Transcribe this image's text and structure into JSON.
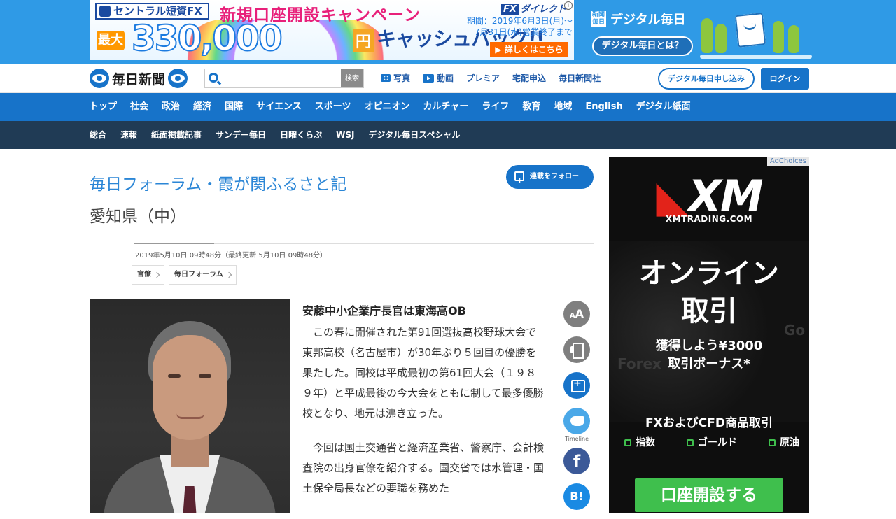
{
  "top_ad": {
    "brand": "セントラル短資FX",
    "campaign": "新規口座開設キャンペーン",
    "max_label": "最大",
    "amount": "330,000",
    "yen": "円",
    "cashback": "キャッシュバック!!",
    "fx_brand_box": "FX",
    "fx_brand_text": "ダイレクト",
    "period_line1": "期間：2019年6月3日(月)～",
    "period_line2": "7月31日(水)営業終了まで",
    "detail_button": "▶ 詳しくはこちら"
  },
  "digital_mainichi": {
    "logo_small": "新聞 毎日",
    "title": "デジタル毎日",
    "about_button": "デジタル毎日とは？"
  },
  "header": {
    "logo_text": "毎日新聞",
    "search_placeholder": "",
    "search_button": "検索",
    "links": [
      "写真",
      "動画",
      "プレミア",
      "宅配申込",
      "毎日新聞社"
    ],
    "apply_button": "デジタル毎日申し込み",
    "login_button": "ログイン"
  },
  "nav_primary": [
    "トップ",
    "社会",
    "政治",
    "経済",
    "国際",
    "サイエンス",
    "スポーツ",
    "オピニオン",
    "カルチャー",
    "ライフ",
    "教育",
    "地域",
    "English",
    "デジタル紙面"
  ],
  "nav_secondary": [
    "総合",
    "速報",
    "紙面掲載記事",
    "サンデー毎日",
    "日曜くらぶ",
    "WSJ",
    "デジタル毎日スペシャル"
  ],
  "article": {
    "series_title": "毎日フォーラム・霞が関ふるさと記",
    "follow_button": "連載をフォロー",
    "subtitle": "愛知県（中）",
    "date": "2019年5月10日 09時48分（最終更新 5月10日 09時48分）",
    "tags": [
      "官僚",
      "毎日フォーラム"
    ],
    "heading": "安藤中小企業庁長官は東海高OB",
    "paragraphs": [
      "この春に開催された第91回選抜高校野球大会で東邦高校（名古屋市）が30年ぶり５回目の優勝を果たした。同校は平成最初の第61回大会（１９８９年）と平成最後の今大会をともに制して最多優勝校となり、地元は沸き立った。",
      "今回は国土交通省と経済産業省、警察庁、会計検査院の出身官僚を紹介する。国交省では水管理・国土保全局長などの要職を務めた"
    ]
  },
  "share": {
    "font_small": "A",
    "font_large": "A",
    "twitter_label": "Timeline",
    "facebook": "f",
    "hatena": "B!"
  },
  "side_ad": {
    "adchoices": "AdChoices",
    "logo": "XM",
    "url": "XMTRADING.COM",
    "headline_line1": "オンライン",
    "headline_line2": "取引",
    "bonus_line1": "獲得しよう¥3000",
    "bonus_line2": "取引ボーナス*",
    "products": "FXおよびCFD商品取引",
    "categories": [
      "指数",
      "ゴールド",
      "原油"
    ],
    "cta": "口座開設する",
    "ghost_text_1": "Forex",
    "ghost_text_2": "Go"
  },
  "colors": {
    "brand_blue": "#1773c9",
    "nav_dark": "#203b55",
    "series_blue": "#2b86d6",
    "cta_green": "#3fbf4d"
  }
}
